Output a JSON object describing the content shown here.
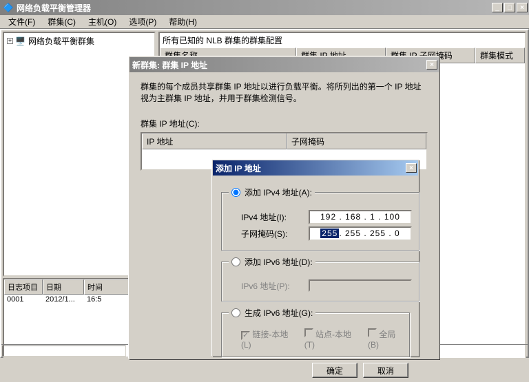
{
  "mainWindow": {
    "title": "网络负载平衡管理器",
    "menu": {
      "file": "文件(F)",
      "cluster": "群集(C)",
      "host": "主机(O)",
      "options": "选项(P)",
      "help": "帮助(H)"
    },
    "tree": {
      "root": "网络负载平衡群集"
    },
    "rightPanel": {
      "heading": "所有已知的 NLB 群集的群集配置",
      "cols": {
        "name": "群集名称",
        "ip": "群集 IP 地址",
        "subnet": "群集 IP 子网掩码",
        "mode": "群集模式"
      }
    },
    "log": {
      "cols": {
        "item": "日志项目",
        "date": "日期",
        "time": "时间"
      },
      "row": {
        "item": "0001",
        "date": "2012/1...",
        "time": "16:5"
      }
    }
  },
  "dlgNewCluster": {
    "title": "新群集:  群集 IP 地址",
    "desc1": "群集的每个成员共享群集 IP 地址以进行负载平衡。将所列出的第一个 IP 地址",
    "desc2": "视为主群集 IP 地址，并用于群集检测信号。",
    "listLabel": "群集 IP 地址(C):",
    "listCols": {
      "ip": "IP 地址",
      "subnet": "子网掩码"
    }
  },
  "dlgAddIp": {
    "title": "添加 IP 地址",
    "radioV4": "添加 IPv4 地址(A):",
    "ipv4Label": "IPv4 地址(I):",
    "ipv4Value": "192 . 168 .  1  . 100",
    "subnetLabel": "子网掩码(S):",
    "subnetOct1": "255",
    "subnetRest": ". 255 . 255 .  0",
    "radioV6": "添加 IPv6 地址(D):",
    "ipv6Label": "IPv6 地址(P):",
    "radioGen": "生成 IPv6 地址(G):",
    "cbLink": "链接-本地(L)",
    "cbSite": "站点-本地(T)",
    "cbGlobal": "全局(B)",
    "ok": "确定",
    "cancel": "取消"
  }
}
